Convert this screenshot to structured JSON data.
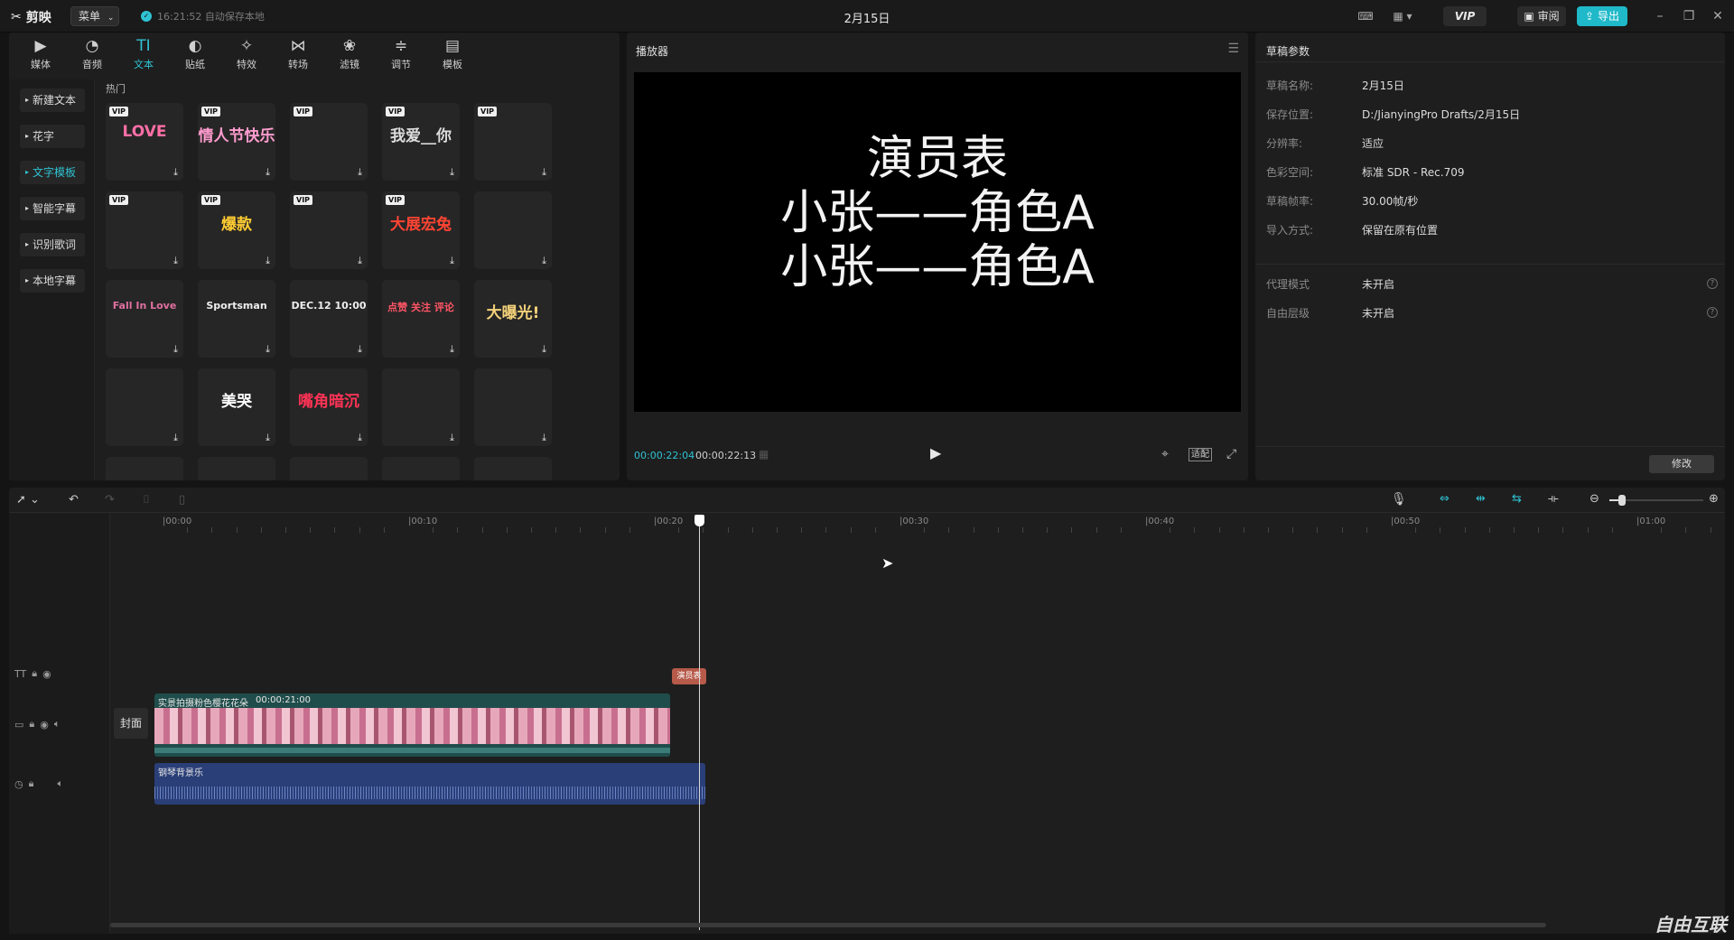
{
  "app": {
    "name": "剪映",
    "menu_label": "菜单",
    "autosave": "16:21:52 自动保存本地",
    "title": "2月15日",
    "vip_label": "VIP",
    "review_label": "审阅",
    "export_label": "导出",
    "accent_color": "#2fc3d3"
  },
  "library": {
    "tabs": [
      {
        "label": "媒体",
        "icon": "media-icon"
      },
      {
        "label": "音频",
        "icon": "audio-icon"
      },
      {
        "label": "文本",
        "icon": "text-icon"
      },
      {
        "label": "贴纸",
        "icon": "sticker-icon"
      },
      {
        "label": "特效",
        "icon": "effects-icon"
      },
      {
        "label": "转场",
        "icon": "transition-icon"
      },
      {
        "label": "滤镜",
        "icon": "filter-icon"
      },
      {
        "label": "调节",
        "icon": "adjust-icon"
      },
      {
        "label": "模板",
        "icon": "template-icon"
      }
    ],
    "active_tab": "文本",
    "side_items": [
      "新建文本",
      "花字",
      "文字模板",
      "智能字幕",
      "识别歌词",
      "本地字幕"
    ],
    "active_side": "文字模板",
    "section_title": "热门",
    "vip_badge": "VIP",
    "template_cards": [
      {
        "art": "LOVE",
        "vip": true,
        "color": "#ff6fa6"
      },
      {
        "art": "情人节快乐",
        "vip": true,
        "color": "#ff9ccf"
      },
      {
        "art": "",
        "vip": true,
        "color": "#888"
      },
      {
        "art": "我爱__你",
        "vip": true,
        "color": "#ddd"
      },
      {
        "art": "",
        "vip": true,
        "color": "#888"
      },
      {
        "art": "",
        "vip": true,
        "color": "#ddd"
      },
      {
        "art": "爆款",
        "vip": true,
        "color": "#ffcc33"
      },
      {
        "art": "",
        "vip": true,
        "color": "#ff8844"
      },
      {
        "art": "大展宏兔",
        "vip": true,
        "color": "#ff4433"
      },
      {
        "art": "",
        "vip": false,
        "color": "#c9b477"
      },
      {
        "art": "Fall In Love",
        "vip": false,
        "color": "#e070a0"
      },
      {
        "art": "Sportsman",
        "vip": false,
        "color": "#eeeeee"
      },
      {
        "art": "DEC.12 10:00",
        "vip": false,
        "color": "#eeeeee"
      },
      {
        "art": "点赞 关注 评论",
        "vip": false,
        "color": "#ff5566"
      },
      {
        "art": "大曝光!",
        "vip": false,
        "color": "#f5d27a"
      },
      {
        "art": "",
        "vip": false,
        "color": "#bbb"
      },
      {
        "art": "美哭",
        "vip": false,
        "color": "#ffffff"
      },
      {
        "art": "嘴角暗沉",
        "vip": false,
        "color": "#ff3355"
      },
      {
        "art": "",
        "vip": false,
        "color": "#ffd0ea"
      },
      {
        "art": "",
        "vip": false,
        "color": "#bbb"
      }
    ]
  },
  "player": {
    "title": "播放器",
    "subtitle_lines": [
      "演员表",
      "小张——角色A",
      "小张——角色A"
    ],
    "current_time": "00:00:22:04",
    "total_time": "00:00:22:13",
    "ratio_label": "适配"
  },
  "draft": {
    "title": "草稿参数",
    "params": [
      {
        "label": "草稿名称:",
        "value": "2月15日"
      },
      {
        "label": "保存位置:",
        "value": "D:/JianyingPro Drafts/2月15日"
      },
      {
        "label": "分辨率:",
        "value": "适应"
      },
      {
        "label": "色彩空间:",
        "value": "标准 SDR - Rec.709"
      },
      {
        "label": "草稿帧率:",
        "value": "30.00帧/秒"
      },
      {
        "label": "导入方式:",
        "value": "保留在原有位置"
      }
    ],
    "params2": [
      {
        "label": "代理模式",
        "value": "未开启"
      },
      {
        "label": "自由层级",
        "value": "未开启"
      }
    ],
    "modify_label": "修改"
  },
  "timeline": {
    "ruler": [
      "|00:00",
      "|00:10",
      "|00:20",
      "|00:30",
      "|00:40",
      "|00:50",
      "|01:00"
    ],
    "cover_label": "封面",
    "text_clip_label": "演员表",
    "video_clip_name": "实景拍摄粉色樱花花朵",
    "video_clip_duration": "00:00:21:00",
    "audio_clip_name": "钢琴背景乐"
  },
  "watermark": "自由互联"
}
